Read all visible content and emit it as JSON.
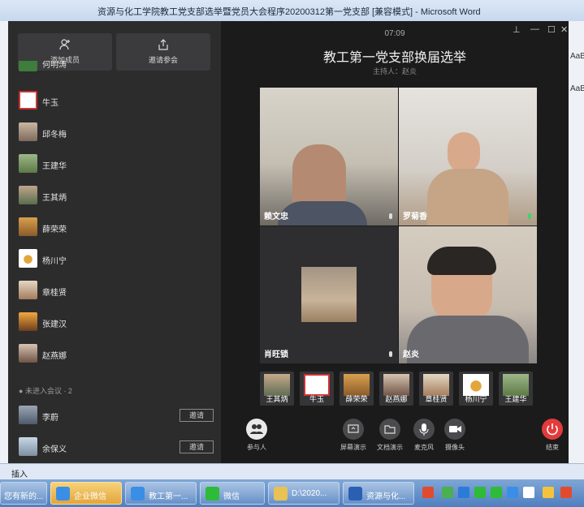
{
  "word_window": {
    "title": "资源与化工学院教工党支部选举暨党员大会程序20200312第一党支部 [兼容模式] - Microsoft Word",
    "right_fragment": "AaB",
    "right_fragment2": "AaB",
    "status_insert": "插入"
  },
  "meeting": {
    "timer": "07:09",
    "title": "教工第一党支部换届选举",
    "host": "主持人：赵炎",
    "sidebar": {
      "add_member": "添加成员",
      "invite_join": "邀请参会",
      "members": [
        {
          "name": "何明涛"
        },
        {
          "name": "牛玉"
        },
        {
          "name": "邱冬梅"
        },
        {
          "name": "王建华"
        },
        {
          "name": "王其炳"
        },
        {
          "name": "薛荣荣"
        },
        {
          "name": "杨川宁"
        },
        {
          "name": "章桂贤"
        },
        {
          "name": "张建汉"
        },
        {
          "name": "赵燕娜"
        }
      ],
      "not_joined_label": "未进入会议 · 2",
      "not_joined": [
        {
          "name": "李蔚",
          "invite": "邀请"
        },
        {
          "name": "余保义",
          "invite": "邀请"
        }
      ]
    },
    "video_tiles": [
      {
        "name": "赖文忠"
      },
      {
        "name": "罗菊香"
      },
      {
        "name": "肖旺锁"
      },
      {
        "name": "赵炎"
      }
    ],
    "thumbnails": [
      {
        "name": "王其炳"
      },
      {
        "name": "牛玉"
      },
      {
        "name": "薛荣荣"
      },
      {
        "name": "赵燕娜"
      },
      {
        "name": "章桂贤"
      },
      {
        "name": "杨川宁"
      },
      {
        "name": "王建华"
      }
    ],
    "toolbar": {
      "participants": "参与人",
      "screen_share": "屏幕演示",
      "doc_share": "文档演示",
      "microphone": "麦克风",
      "camera": "摄像头",
      "end": "结束"
    }
  },
  "taskbar": {
    "items": [
      {
        "label": "您有新的..."
      },
      {
        "label": "企业微信"
      },
      {
        "label": "教工第一..."
      },
      {
        "label": "微信"
      },
      {
        "label": "D:\\2020..."
      },
      {
        "label": "资源与化..."
      }
    ]
  }
}
